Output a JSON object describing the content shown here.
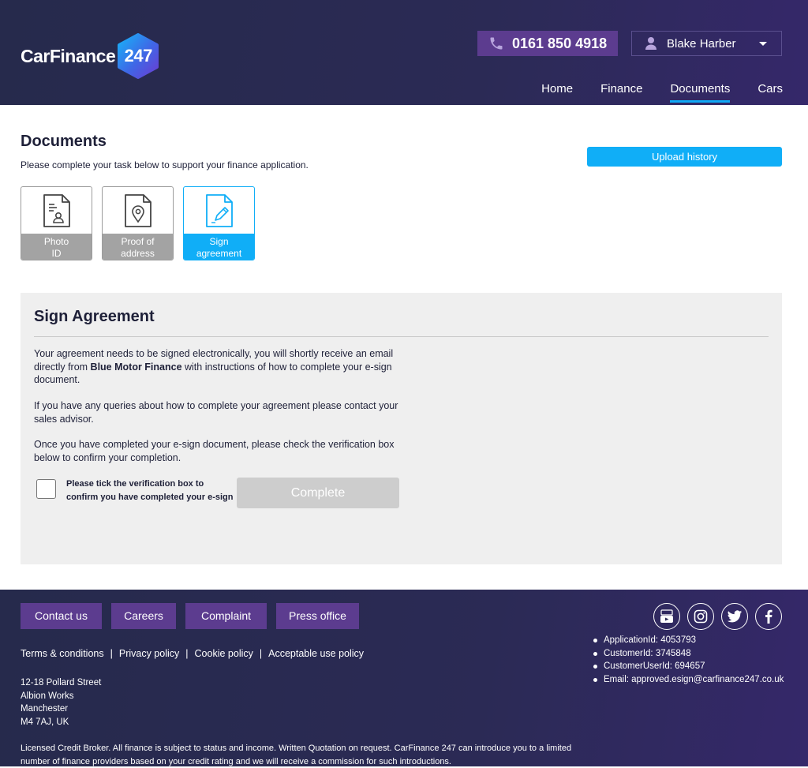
{
  "header": {
    "logo_text": "CarFinance",
    "logo_number": "247",
    "phone": "0161 850 4918",
    "user_name": "Blake Harber",
    "nav": [
      "Home",
      "Finance",
      "Documents",
      "Cars"
    ],
    "active_nav": "Documents"
  },
  "documents": {
    "title": "Documents",
    "subtitle": "Please complete your task below to support your finance application.",
    "upload_history_label": "Upload history",
    "tasks": [
      {
        "label_line1": "Photo",
        "label_line2": "ID",
        "icon": "id-document-icon",
        "active": false
      },
      {
        "label_line1": "Proof of",
        "label_line2": "address",
        "icon": "address-document-icon",
        "active": false
      },
      {
        "label_line1": "Sign",
        "label_line2": "agreement",
        "icon": "sign-document-icon",
        "active": true
      }
    ]
  },
  "sign_agreement": {
    "title": "Sign Agreement",
    "para1_before": "Your agreement needs to be signed electronically, you will shortly receive an email directly from ",
    "para1_bold": "Blue Motor Finance",
    "para1_after": " with instructions of how to complete your e-sign document.",
    "para2": "If you have any queries about how to complete your agreement please contact your sales advisor.",
    "para3": "Once you have completed your e-sign document, please check the verification box below to confirm your completion.",
    "checkbox_label": "Please tick the verification box to confirm you have completed your e-sign",
    "complete_label": "Complete"
  },
  "footer": {
    "buttons": [
      "Contact us",
      "Careers",
      "Complaint",
      "Press office"
    ],
    "legal_links": [
      "Terms & conditions",
      "Privacy policy",
      "Cookie policy",
      "Acceptable use policy"
    ],
    "separator": "|",
    "address": [
      "12-18 Pollard Street",
      "Albion Works",
      "Manchester",
      "M4 7AJ, UK"
    ],
    "disclaimer": "Licensed Credit Broker. All finance is subject to status and income. Written Quotation on request. CarFinance 247 can introduce you to a limited number of finance providers based on your credit rating and we will receive a commission for such introductions.",
    "social": [
      "youtube-icon",
      "instagram-icon",
      "twitter-icon",
      "facebook-icon"
    ],
    "ids": [
      "ApplicationId: 4053793",
      "CustomerId: 3745848",
      "CustomerUserId: 694657",
      "Email: approved.esign@carfinance247.co.uk"
    ]
  },
  "colors": {
    "header_bg": "#2b2a55",
    "accent_purple": "#5c3c8f",
    "accent_blue": "#10aef7",
    "panel_bg": "#efefef",
    "disabled_gray": "#cdcdcd"
  }
}
